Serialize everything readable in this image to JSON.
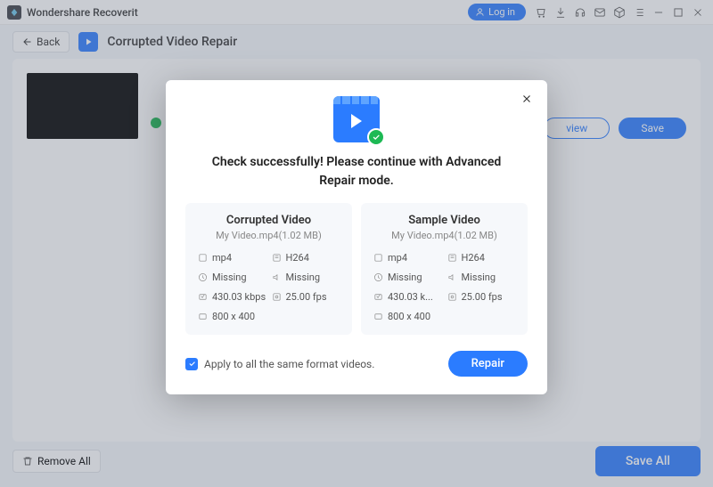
{
  "app_name": "Wondershare Recoverit",
  "login_label": "Log in",
  "back_label": "Back",
  "page_title": "Corrupted Video Repair",
  "preview_label": "view",
  "save_label": "Save",
  "remove_all_label": "Remove All",
  "save_all_label": "Save All",
  "modal": {
    "headline": "Check successfully! Please continue with Advanced Repair mode.",
    "apply_label": "Apply to all the same format videos.",
    "repair_label": "Repair",
    "cards": [
      {
        "title": "Corrupted Video",
        "sub": "My Video.mp4(1.02   MB)",
        "c0": "mp4",
        "c1": "H264",
        "c2": "Missing",
        "c3": "Missing",
        "c4": "430.03 kbps",
        "c5": "25.00 fps",
        "c6": "800 x 400"
      },
      {
        "title": "Sample Video",
        "sub": "My Video.mp4(1.02   MB)",
        "c0": "mp4",
        "c1": "H264",
        "c2": "Missing",
        "c3": "Missing",
        "c4": "430.03 k...",
        "c5": "25.00 fps",
        "c6": "800 x 400"
      }
    ]
  }
}
